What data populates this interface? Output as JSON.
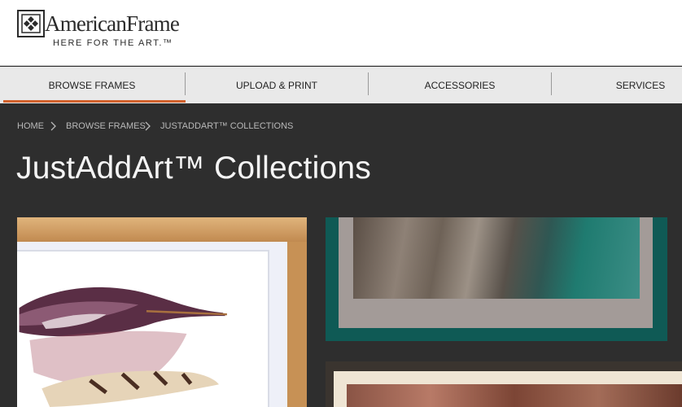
{
  "brand": {
    "name": "AmericanFrame",
    "tagline": "HERE FOR THE ART.™",
    "icon": "framed-square-logo-icon"
  },
  "nav": {
    "items": [
      {
        "label": "BROWSE FRAMES",
        "active": true
      },
      {
        "label": "UPLOAD & PRINT",
        "active": false
      },
      {
        "label": "ACCESSORIES",
        "active": false
      },
      {
        "label": "SERVICES",
        "active": false
      }
    ],
    "active_color": "#d2612c"
  },
  "breadcrumb": {
    "items": [
      "HOME",
      "BROWSE FRAMES",
      "JUSTADDART™ COLLECTIONS"
    ],
    "separator_icon": "chevron-right-icon"
  },
  "page": {
    "title": "JustAddArt™ Collections"
  },
  "products": [
    {
      "image": "Watercolor feathers print in natural wood frame with white mat"
    },
    {
      "image": "Rocky coastline photo in teal frame with gray mat"
    },
    {
      "image": "Embossed copper artwork in dark frame with cream mat"
    }
  ],
  "colors": {
    "page_background": "#2e2e2e",
    "nav_background": "#e9e9e9",
    "accent": "#d2612c"
  }
}
